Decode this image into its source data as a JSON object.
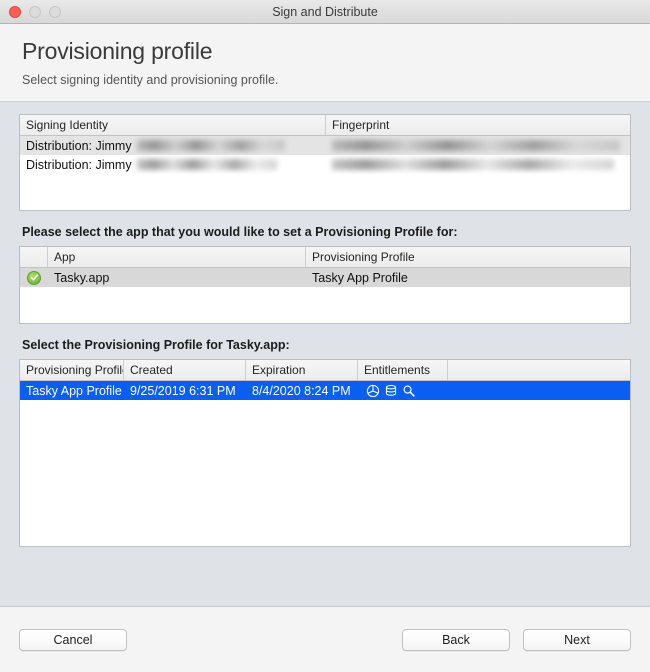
{
  "window": {
    "title": "Sign and Distribute",
    "traffic_lights": [
      "close-button",
      "minimize-button",
      "maximize-button"
    ]
  },
  "header": {
    "title": "Provisioning profile",
    "subtitle": "Select signing identity and provisioning profile."
  },
  "identity_table": {
    "columns": [
      "Signing Identity",
      "Fingerprint"
    ],
    "rows": [
      {
        "identity": "Distribution: Jimmy",
        "identity_redacted": true,
        "fingerprint": "",
        "fingerprint_redacted": true
      },
      {
        "identity": "Distribution: Jimmy",
        "identity_redacted": true,
        "fingerprint": "",
        "fingerprint_redacted": true
      }
    ]
  },
  "apps_section": {
    "label": "Please select the app that you would like to set a Provisioning Profile for:",
    "columns": [
      "",
      "App",
      "Provisioning Profile"
    ],
    "rows": [
      {
        "checked": true,
        "check_icon": "green-check-icon",
        "app": "Tasky.app",
        "profile": "Tasky App Profile",
        "selected": true
      }
    ]
  },
  "profiles_section": {
    "label": "Select the Provisioning Profile for Tasky.app:",
    "columns": [
      "Provisioning Profile",
      "Created",
      "Expiration",
      "Entitlements",
      ""
    ],
    "rows": [
      {
        "profile": "Tasky App Profile",
        "created": "9/25/2019 6:31 PM",
        "expiration": "8/4/2020 8:24 PM",
        "entitlements": [
          "app-groups-icon",
          "icloud-database-icon",
          "keychain-search-icon"
        ],
        "selected": true
      }
    ]
  },
  "footer": {
    "cancel_label": "Cancel",
    "back_label": "Back",
    "next_label": "Next"
  },
  "colors": {
    "selection_blue": "#0a5ff0",
    "check_green": "#7dc242",
    "close_red": "#ff5f57",
    "body_background": "#dfe3e8",
    "header_background": "#f4f4f4"
  }
}
